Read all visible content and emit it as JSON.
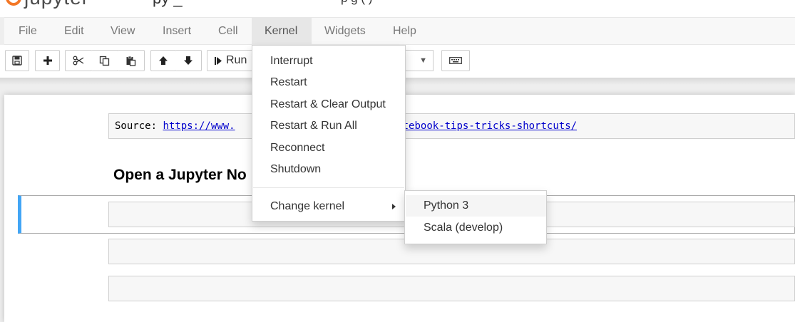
{
  "header": {
    "logo_text": "jupyter",
    "notebook_name_fragment": "py  _",
    "status_fragment": "p                   g  (          )"
  },
  "menubar": {
    "items": [
      "File",
      "Edit",
      "View",
      "Insert",
      "Cell",
      "Kernel",
      "Widgets",
      "Help"
    ],
    "active": "Kernel"
  },
  "toolbar": {
    "run_label": "Run"
  },
  "kernel_menu": {
    "items": [
      "Interrupt",
      "Restart",
      "Restart & Clear Output",
      "Restart & Run All",
      "Reconnect",
      "Shutdown"
    ],
    "change_kernel_label": "Change kernel"
  },
  "change_kernel_submenu": {
    "items": [
      "Python 3",
      "Scala (develop)"
    ],
    "highlighted": "Python 3"
  },
  "notebook": {
    "source_label": "Source:",
    "source_link_left": "https://www.",
    "source_link_right": "ter-notebook-tips-tricks-shortcuts/",
    "heading_visible": "Open a Jupyter No"
  },
  "colors": {
    "selected_cell_border": "#42a5f5",
    "link": "#0000cc",
    "logo_orange": "#f37726"
  },
  "icons": [
    "save-icon",
    "plus-icon",
    "scissors-icon",
    "copy-icon",
    "paste-icon",
    "arrow-up-icon",
    "arrow-down-icon",
    "step-forward-icon",
    "keyboard-icon",
    "caret-down-icon",
    "caret-right-icon"
  ]
}
